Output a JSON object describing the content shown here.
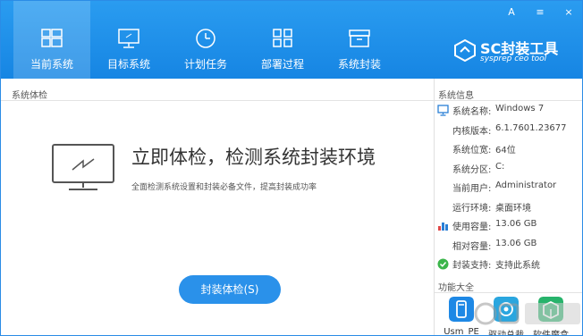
{
  "window": {
    "controls": [
      "A",
      "≡",
      "×"
    ]
  },
  "tabs": [
    {
      "label": "当前系统",
      "icon": "windows-icon",
      "active": true
    },
    {
      "label": "目标系统",
      "icon": "monitor-icon",
      "active": false
    },
    {
      "label": "计划任务",
      "icon": "clock-icon",
      "active": false
    },
    {
      "label": "部署过程",
      "icon": "grid-icon",
      "active": false
    },
    {
      "label": "系统封装",
      "icon": "package-icon",
      "active": false
    }
  ],
  "logo": {
    "title": "SC封装工具",
    "subtitle": "sysprep ceo tool"
  },
  "check_panel": {
    "section_title": "系统体检",
    "headline": "立即体检，检测系统封装环境",
    "description": "全面检测系统设置和封装必备文件，提高封装成功率",
    "button_label": "封装体检(S)"
  },
  "sysinfo": {
    "title": "系统信息",
    "rows": [
      {
        "key": "系统名称:",
        "value": "Windows 7",
        "icon": "monitor-icon"
      },
      {
        "key": "内核版本:",
        "value": "6.1.7601.23677",
        "icon": ""
      },
      {
        "key": "系统位宽:",
        "value": "64位",
        "icon": ""
      },
      {
        "key": "系统分区:",
        "value": "C:",
        "icon": ""
      },
      {
        "key": "当前用户:",
        "value": "Administrator",
        "icon": ""
      },
      {
        "key": "运行环境:",
        "value": "桌面环境",
        "icon": ""
      },
      {
        "key": "使用容量:",
        "value": "13.06 GB",
        "icon": "bar-chart-icon"
      },
      {
        "key": "相对容量:",
        "value": "13.06 GB",
        "icon": ""
      },
      {
        "key": "封装支持:",
        "value": "支持此系统",
        "icon": "check-circle-icon"
      }
    ]
  },
  "functions": {
    "title": "功能大全",
    "items": [
      {
        "label": "Usm_PE",
        "icon": "usm-pe-icon",
        "color": "#1e88e5"
      },
      {
        "label": "驱动总裁",
        "icon": "driver-icon",
        "color": "#2aa6df"
      },
      {
        "label": "软件魔盒",
        "icon": "software-box-icon",
        "color": "#27b36b"
      }
    ]
  },
  "colors": {
    "header": "#1f8fea",
    "accent": "#2a91ea",
    "success": "#3bb54a"
  }
}
